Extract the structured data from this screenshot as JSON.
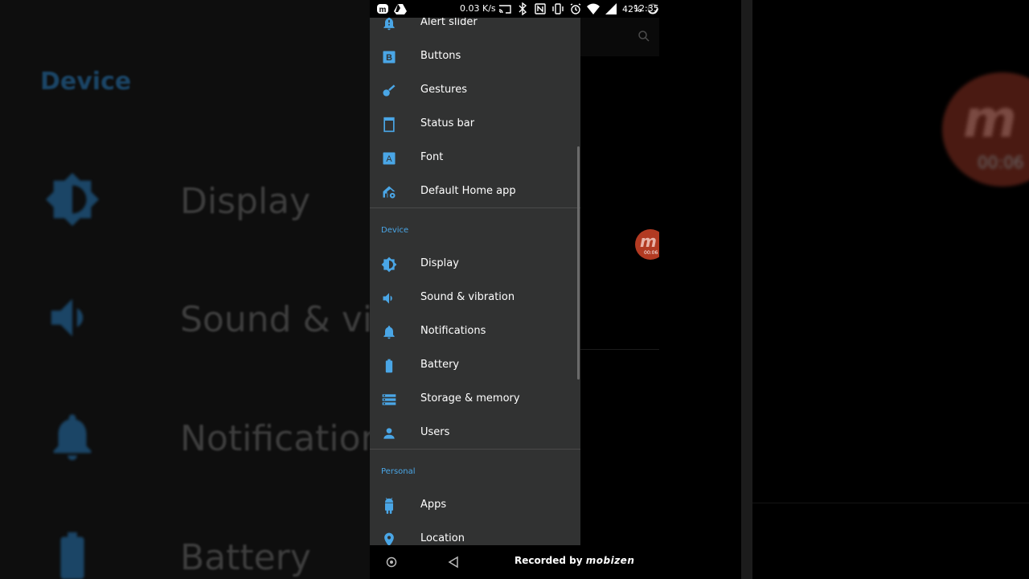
{
  "background": {
    "title": "Device",
    "items": [
      "Display",
      "Sound & vib",
      "Notification",
      "Battery"
    ]
  },
  "recording_overlay": {
    "logo": "m",
    "time": "00:06"
  },
  "status_bar": {
    "network_speed": "0.03 K/s",
    "battery_percent": "42%",
    "time": "12:35"
  },
  "drawer": {
    "items_top": [
      {
        "label": "Alert slider",
        "icon": "bell-alert-icon"
      },
      {
        "label": "Buttons",
        "icon": "buttons-icon"
      },
      {
        "label": "Gestures",
        "icon": "gestures-icon"
      },
      {
        "label": "Status bar",
        "icon": "status-bar-icon"
      },
      {
        "label": "Font",
        "icon": "font-icon"
      },
      {
        "label": "Default Home app",
        "icon": "home-settings-icon"
      }
    ],
    "section_device": "Device",
    "items_device": [
      {
        "label": "Display",
        "icon": "brightness-icon"
      },
      {
        "label": "Sound & vibration",
        "icon": "volume-icon"
      },
      {
        "label": "Notifications",
        "icon": "bell-icon"
      },
      {
        "label": "Battery",
        "icon": "battery-icon"
      },
      {
        "label": "Storage & memory",
        "icon": "storage-icon"
      },
      {
        "label": "Users",
        "icon": "person-icon"
      }
    ],
    "section_personal": "Personal",
    "items_personal": [
      {
        "label": "Apps",
        "icon": "android-icon"
      },
      {
        "label": "Location",
        "icon": "location-pin-icon"
      }
    ]
  },
  "nav": {
    "recorded_prefix": "Recorded by",
    "recorded_brand": "mobizen"
  },
  "colors": {
    "accent": "#4aa6e6",
    "drawer_bg": "#313232",
    "record_red": "#b23a22"
  }
}
